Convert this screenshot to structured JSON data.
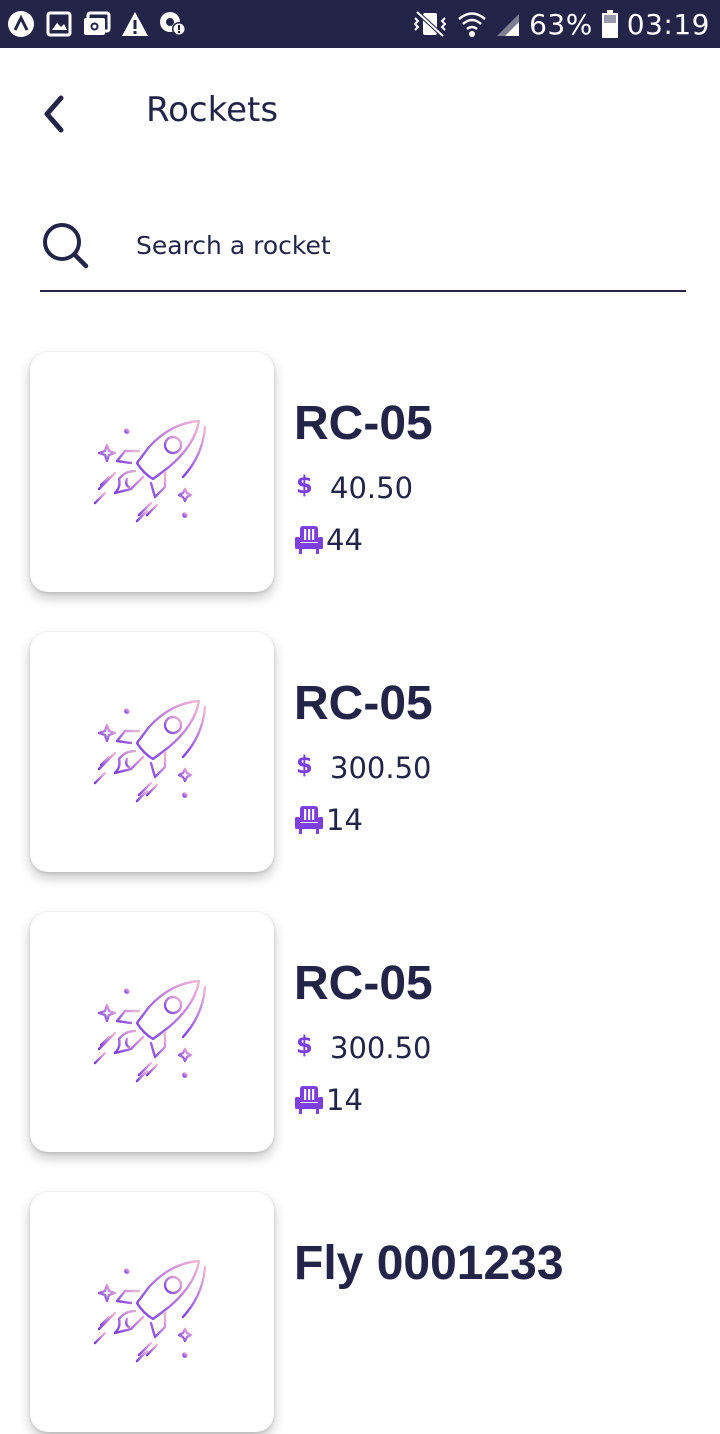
{
  "status_bar": {
    "battery": "63%",
    "time": "03:19",
    "left_icons": [
      "app-icon",
      "image-icon",
      "cast-icon",
      "warning-icon",
      "settings-alert-icon"
    ],
    "right_icons": [
      "vibrate-off-icon",
      "wifi-icon",
      "signal-icon",
      "battery-icon"
    ]
  },
  "header": {
    "title": "Rockets",
    "back_icon": "chevron-left-icon"
  },
  "search": {
    "placeholder": "Search a rocket",
    "value": ""
  },
  "rockets": [
    {
      "name": "RC-05",
      "currency": "$",
      "price": "40.50",
      "seats": "44"
    },
    {
      "name": "RC-05",
      "currency": "$",
      "price": "300.50",
      "seats": "14"
    },
    {
      "name": "RC-05",
      "currency": "$",
      "price": "300.50",
      "seats": "14"
    },
    {
      "name": "Fly 0001233",
      "currency": "$",
      "price": "",
      "seats": ""
    }
  ],
  "colors": {
    "status_bar": "#232448",
    "text": "#232448",
    "accent": "#7b3fe4",
    "rocket_gradient_start": "#7b3fe4",
    "rocket_gradient_end": "#f2b9d4"
  }
}
